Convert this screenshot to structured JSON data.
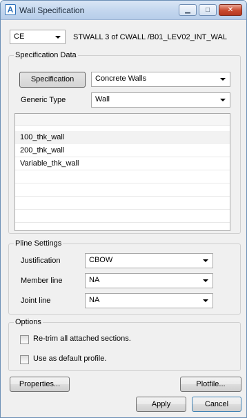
{
  "window": {
    "title": "Wall Specification",
    "minimize_glyph": "▁",
    "maximize_glyph": "□",
    "close_glyph": "✕"
  },
  "header": {
    "mode_value": "CE",
    "element_path": "STWALL 3 of CWALL /B01_LEV02_INT_WAL"
  },
  "specification": {
    "group_title": "Specification Data",
    "spec_button_label": "Specification",
    "spec_value": "Concrete Walls",
    "generic_type_label": "Generic Type",
    "generic_type_value": "Wall",
    "list_items": [
      "100_thk_wall",
      "200_thk_wall",
      "Variable_thk_wall"
    ],
    "selected_index": 0
  },
  "pline": {
    "group_title": "Pline Settings",
    "justification_label": "Justification",
    "justification_value": "CBOW",
    "member_line_label": "Member line",
    "member_line_value": "NA",
    "joint_line_label": "Joint line",
    "joint_line_value": "NA"
  },
  "options": {
    "group_title": "Options",
    "retrim_label": "Re-trim all attached sections.",
    "retrim_checked": false,
    "default_profile_label": "Use as default profile.",
    "default_profile_checked": false
  },
  "buttons": {
    "properties": "Properties...",
    "plotfile": "Plotfile...",
    "apply": "Apply",
    "cancel": "Cancel"
  }
}
